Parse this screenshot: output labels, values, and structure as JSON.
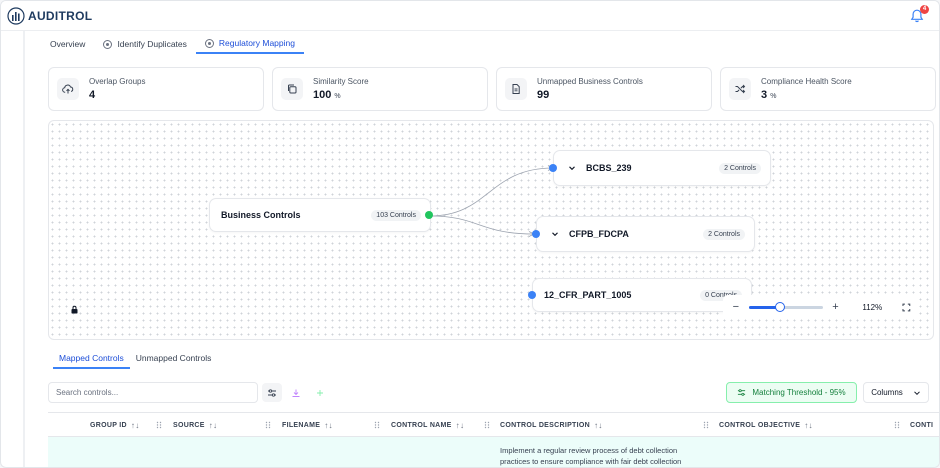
{
  "app": {
    "name": "AUDITROL",
    "notification_count": "4"
  },
  "tabs": [
    {
      "label": "Overview",
      "active": false
    },
    {
      "label": "Identify Duplicates",
      "active": false
    },
    {
      "label": "Regulatory Mapping",
      "active": true
    }
  ],
  "stats": [
    {
      "label": "Overlap Groups",
      "value": "4",
      "unit": "",
      "icon": "cloud-upload-icon"
    },
    {
      "label": "Similarity Score",
      "value": "100",
      "unit": "%",
      "icon": "copy-icon"
    },
    {
      "label": "Unmapped Business Controls",
      "value": "99",
      "unit": "",
      "icon": "document-icon"
    },
    {
      "label": "Compliance Health Score",
      "value": "3",
      "unit": "%",
      "icon": "shuffle-icon"
    }
  ],
  "graph": {
    "source": {
      "name": "Business Controls",
      "badge": "103 Controls"
    },
    "targets": [
      {
        "name": "BCBS_239",
        "badge": "2 Controls",
        "expandable": true
      },
      {
        "name": "CFPB_FDCPA",
        "badge": "2 Controls",
        "expandable": true
      },
      {
        "name": "12_CFR_PART_1005",
        "badge": "0 Controls",
        "expandable": false
      }
    ],
    "colors": {
      "source_dot": "#22c55e",
      "target_dot": "#3b82f6",
      "edge": "#9ca3af"
    }
  },
  "zoom": {
    "minus": "−",
    "plus": "+",
    "level": "112%",
    "fraction": 0.42
  },
  "sub_tabs": [
    {
      "label": "Mapped Controls",
      "active": true
    },
    {
      "label": "Unmapped Controls",
      "active": false
    }
  ],
  "toolbar": {
    "search_placeholder": "Search controls...",
    "threshold_label": "Matching Threshold - 95%",
    "columns_label": "Columns"
  },
  "table": {
    "columns": [
      "GROUP ID",
      "SOURCE",
      "FILENAME",
      "CONTROL NAME",
      "CONTROL DESCRIPTION",
      "CONTROL OBJECTIVE",
      "CONTI"
    ],
    "sort_glyph": "↑↓",
    "rows": [
      {
        "control_description": "Implement a regular review process of debt collection practices to ensure compliance with fair debt collection"
      }
    ]
  }
}
